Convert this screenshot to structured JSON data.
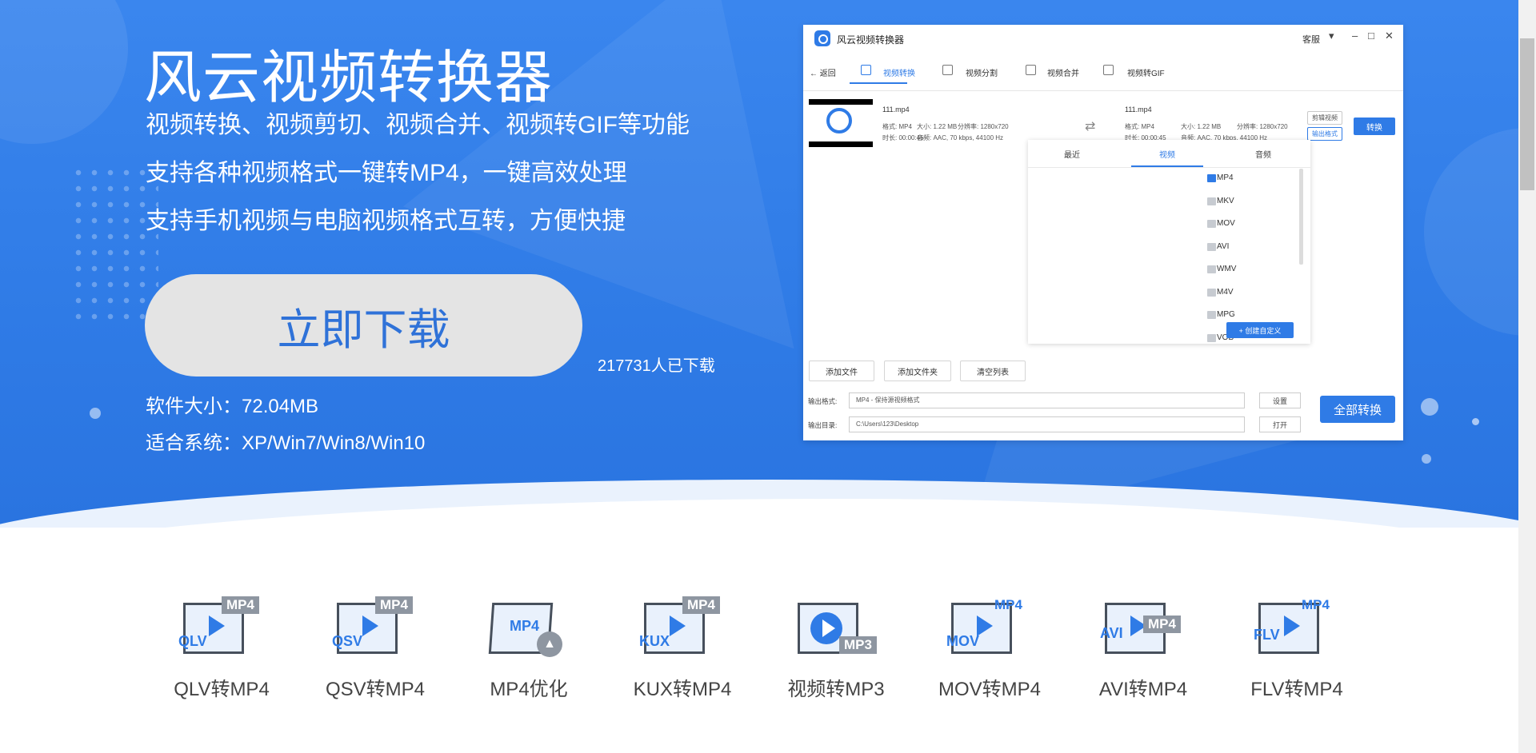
{
  "hero": {
    "title": "风云视频转换器",
    "lines": [
      "视频转换、视频剪切、视频合并、视频转GIF等功能",
      "支持各种视频格式一键转MP4，一键高效处理",
      "支持手机视频与电脑视频格式互转，方便快捷"
    ],
    "download_label": "立即下载",
    "download_count": "217731人已下载",
    "size": "软件大小：72.04MB",
    "system": "适合系统：XP/Win7/Win8/Win10"
  },
  "app": {
    "title": "风云视频转换器",
    "kefu": "客服",
    "controls": [
      "▾",
      "–",
      "□",
      "✕"
    ],
    "nav": [
      "返回",
      "视频转换",
      "视频分割",
      "视频合并",
      "视频转GIF"
    ],
    "file": {
      "src_name": "111.mp4",
      "src_format": "格式: MP4",
      "src_size": "大小: 1.22 MB",
      "src_res": "分辨率: 1280x720",
      "src_duration": "时长: 00:00:45",
      "src_audio": "音频: AAC, 70 kbps, 44100 Hz",
      "dst_name": "111.mp4",
      "dst_format": "格式: MP4",
      "dst_size": "大小: 1.22 MB",
      "dst_res": "分辨率: 1280x720",
      "dst_duration": "时长: 00:00:45",
      "dst_audio": "音频: AAC, 70 kbps, 44100 Hz",
      "btn_edit": "剪辑视频",
      "btn_format": "输出格式",
      "btn_convert": "转换"
    },
    "popup": {
      "tabs": [
        "最近",
        "视频",
        "音频"
      ],
      "formats": [
        "MP4",
        "MKV",
        "MOV",
        "AVI",
        "WMV",
        "M4V",
        "MPG",
        "VOB"
      ],
      "create": "+ 创建自定义"
    },
    "tools": [
      "添加文件",
      "添加文件夹",
      "清空列表"
    ],
    "output": {
      "format_label": "输出格式:",
      "format_value": "MP4 - 保持源视频格式",
      "settings": "设置",
      "dir_label": "输出目录:",
      "dir_value": "C:\\Users\\123\\Desktop",
      "open": "打开",
      "convert_all": "全部转换"
    }
  },
  "tools": [
    {
      "label": "QLV转MP4",
      "tag": "QLV",
      "badge": "MP4"
    },
    {
      "label": "QSV转MP4",
      "tag": "QSV",
      "badge": "MP4"
    },
    {
      "label": "MP4优化",
      "tag": "",
      "badge": "MP4"
    },
    {
      "label": "KUX转MP4",
      "tag": "KUX",
      "badge": "MP4"
    },
    {
      "label": "视频转MP3",
      "tag": "",
      "badge": "MP3"
    },
    {
      "label": "MOV转MP4",
      "tag": "MOV",
      "badge": "MP4"
    },
    {
      "label": "AVI转MP4",
      "tag": "AVI",
      "badge": "MP4"
    },
    {
      "label": "FLV转MP4",
      "tag": "FLV",
      "badge": "MP4"
    }
  ]
}
